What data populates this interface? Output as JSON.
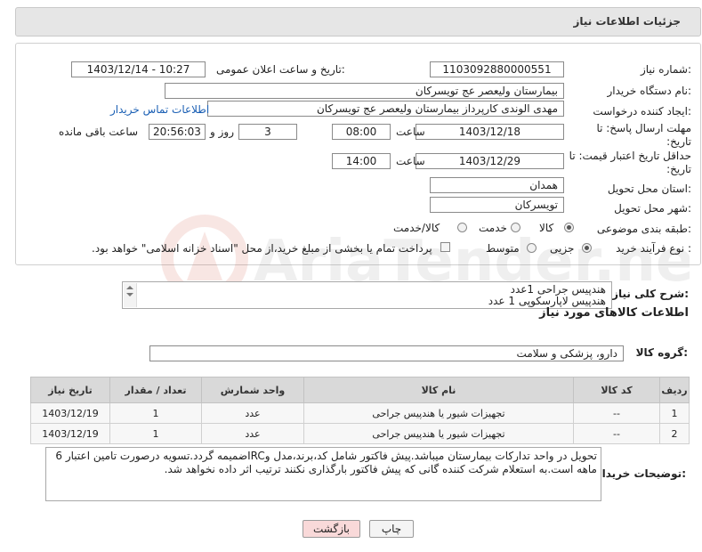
{
  "header": {
    "title": "جزئیات اطلاعات نیاز"
  },
  "form": {
    "need_number_label": "شماره نیاز:",
    "need_number": "1103092880000551",
    "announce_label": "تاریخ و ساعت اعلان عمومی:",
    "announce_value": "1403/12/14 - 10:27",
    "buyer_org_label": "نام دستگاه خریدار:",
    "buyer_org": "بیمارستان ولیعصر  عج  تویسرکان",
    "creator_label": "ایجاد کننده درخواست:",
    "creator": "مهدی الوندی کارپرداز بیمارستان ولیعصر  عج  تویسرکان",
    "contact_link": "اطلاعات تماس خریدار",
    "deadline_label": "مهلت ارسال پاسخ: تا تاریخ:",
    "deadline_date": "1403/12/18",
    "time_label": "ساعت",
    "deadline_time": "08:00",
    "days_value": "3",
    "days_label": "روز و",
    "remaining_time": "20:56:03",
    "remaining_label": "ساعت باقی مانده",
    "validity_label": "حداقل تاریخ اعتبار قیمت: تا تاریخ:",
    "validity_date": "1403/12/29",
    "validity_time": "14:00",
    "province_label": "استان محل تحویل:",
    "province": "همدان",
    "city_label": "شهر محل تحویل:",
    "city": "تویسرکان",
    "category_label": "طبقه بندی موضوعی:",
    "category_options": [
      "کالا",
      "خدمت",
      "کالا/خدمت"
    ],
    "process_label": "نوع فرآیند خرید :",
    "process_options": [
      "جزیی",
      "متوسط"
    ],
    "payment_note": "پرداخت تمام یا بخشی از مبلغ خرید،از محل \"اسناد خزانه اسلامی\" خواهد بود."
  },
  "summary": {
    "label": "شرح کلی نیاز:",
    "lines": [
      "هندپیس جراحی 1عدد",
      "هندپیس لاپارسکوپی 1 عدد"
    ]
  },
  "goods_section": {
    "title": "اطلاعات کالاهای مورد نیاز"
  },
  "goods_group": {
    "label": "گروه کالا:",
    "value": "دارو، پزشکی و سلامت"
  },
  "table": {
    "headers": [
      "ردیف",
      "کد کالا",
      "نام کالا",
      "واحد شمارش",
      "تعداد / مقدار",
      "تاریخ نیاز"
    ],
    "rows": [
      [
        "1",
        "--",
        "تجهیزات شیور یا هندپیس جراحی",
        "عدد",
        "1",
        "1403/12/19"
      ],
      [
        "2",
        "--",
        "تجهیزات شیور یا هندپیس جراحی",
        "عدد",
        "1",
        "1403/12/19"
      ]
    ]
  },
  "buyer_notes": {
    "label": "توضیحات خریدار:",
    "text": "تحویل در واحد تدارکات بیمارستان میباشد.پیش فاکتور شامل کد،برند،مدل وIRCضمیمه گردد.تسویه درصورت تامین اعتبار 6 ماهه است.به استعلام شرکت کننده گانی که پیش فاکتور بارگذاری نکنند ترتیب اثر داده نخواهد شد."
  },
  "buttons": {
    "print": "چاپ",
    "back": "بازگشت"
  },
  "watermark": "AriaTender.neT",
  "colors": {
    "link": "#1a5fb4",
    "back_button_bg": "#f9d9d9",
    "header_bg": "#e6e6e6"
  }
}
